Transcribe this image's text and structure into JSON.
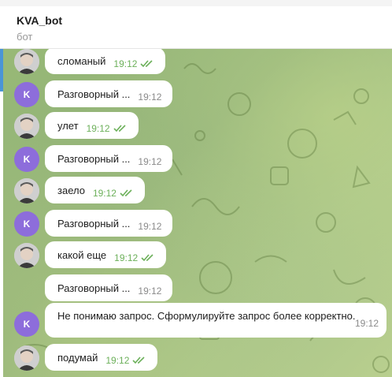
{
  "chat": {
    "title": "KVA_bot",
    "subtitle": "бот"
  },
  "bot_avatar_letter": "K",
  "messages": [
    {
      "text": "сломаный",
      "time": "19:12",
      "sender": "user"
    },
    {
      "text": "Разговорный ...",
      "time": "19:12",
      "sender": "bot"
    },
    {
      "text": "улет",
      "time": "19:12",
      "sender": "user"
    },
    {
      "text": "Разговорный ...",
      "time": "19:12",
      "sender": "bot"
    },
    {
      "text": "заело",
      "time": "19:12",
      "sender": "user"
    },
    {
      "text": "Разговорный ...",
      "time": "19:12",
      "sender": "bot"
    },
    {
      "text": "какой еще",
      "time": "19:12",
      "sender": "user"
    },
    {
      "text": "Разговорный ...",
      "time": "19:12",
      "sender": "bot"
    },
    {
      "text": "Не понимаю запрос. Сформулируйте запрос более корректно.",
      "time": "19:12",
      "sender": "bot"
    },
    {
      "text": "подумай",
      "time": "19:12",
      "sender": "user"
    }
  ],
  "colors": {
    "accent": "#4a95d6",
    "bot_avatar": "#8d6ddb",
    "read_checks": "#6cb05a"
  },
  "icons": {
    "read_receipt": "double-check-icon"
  }
}
